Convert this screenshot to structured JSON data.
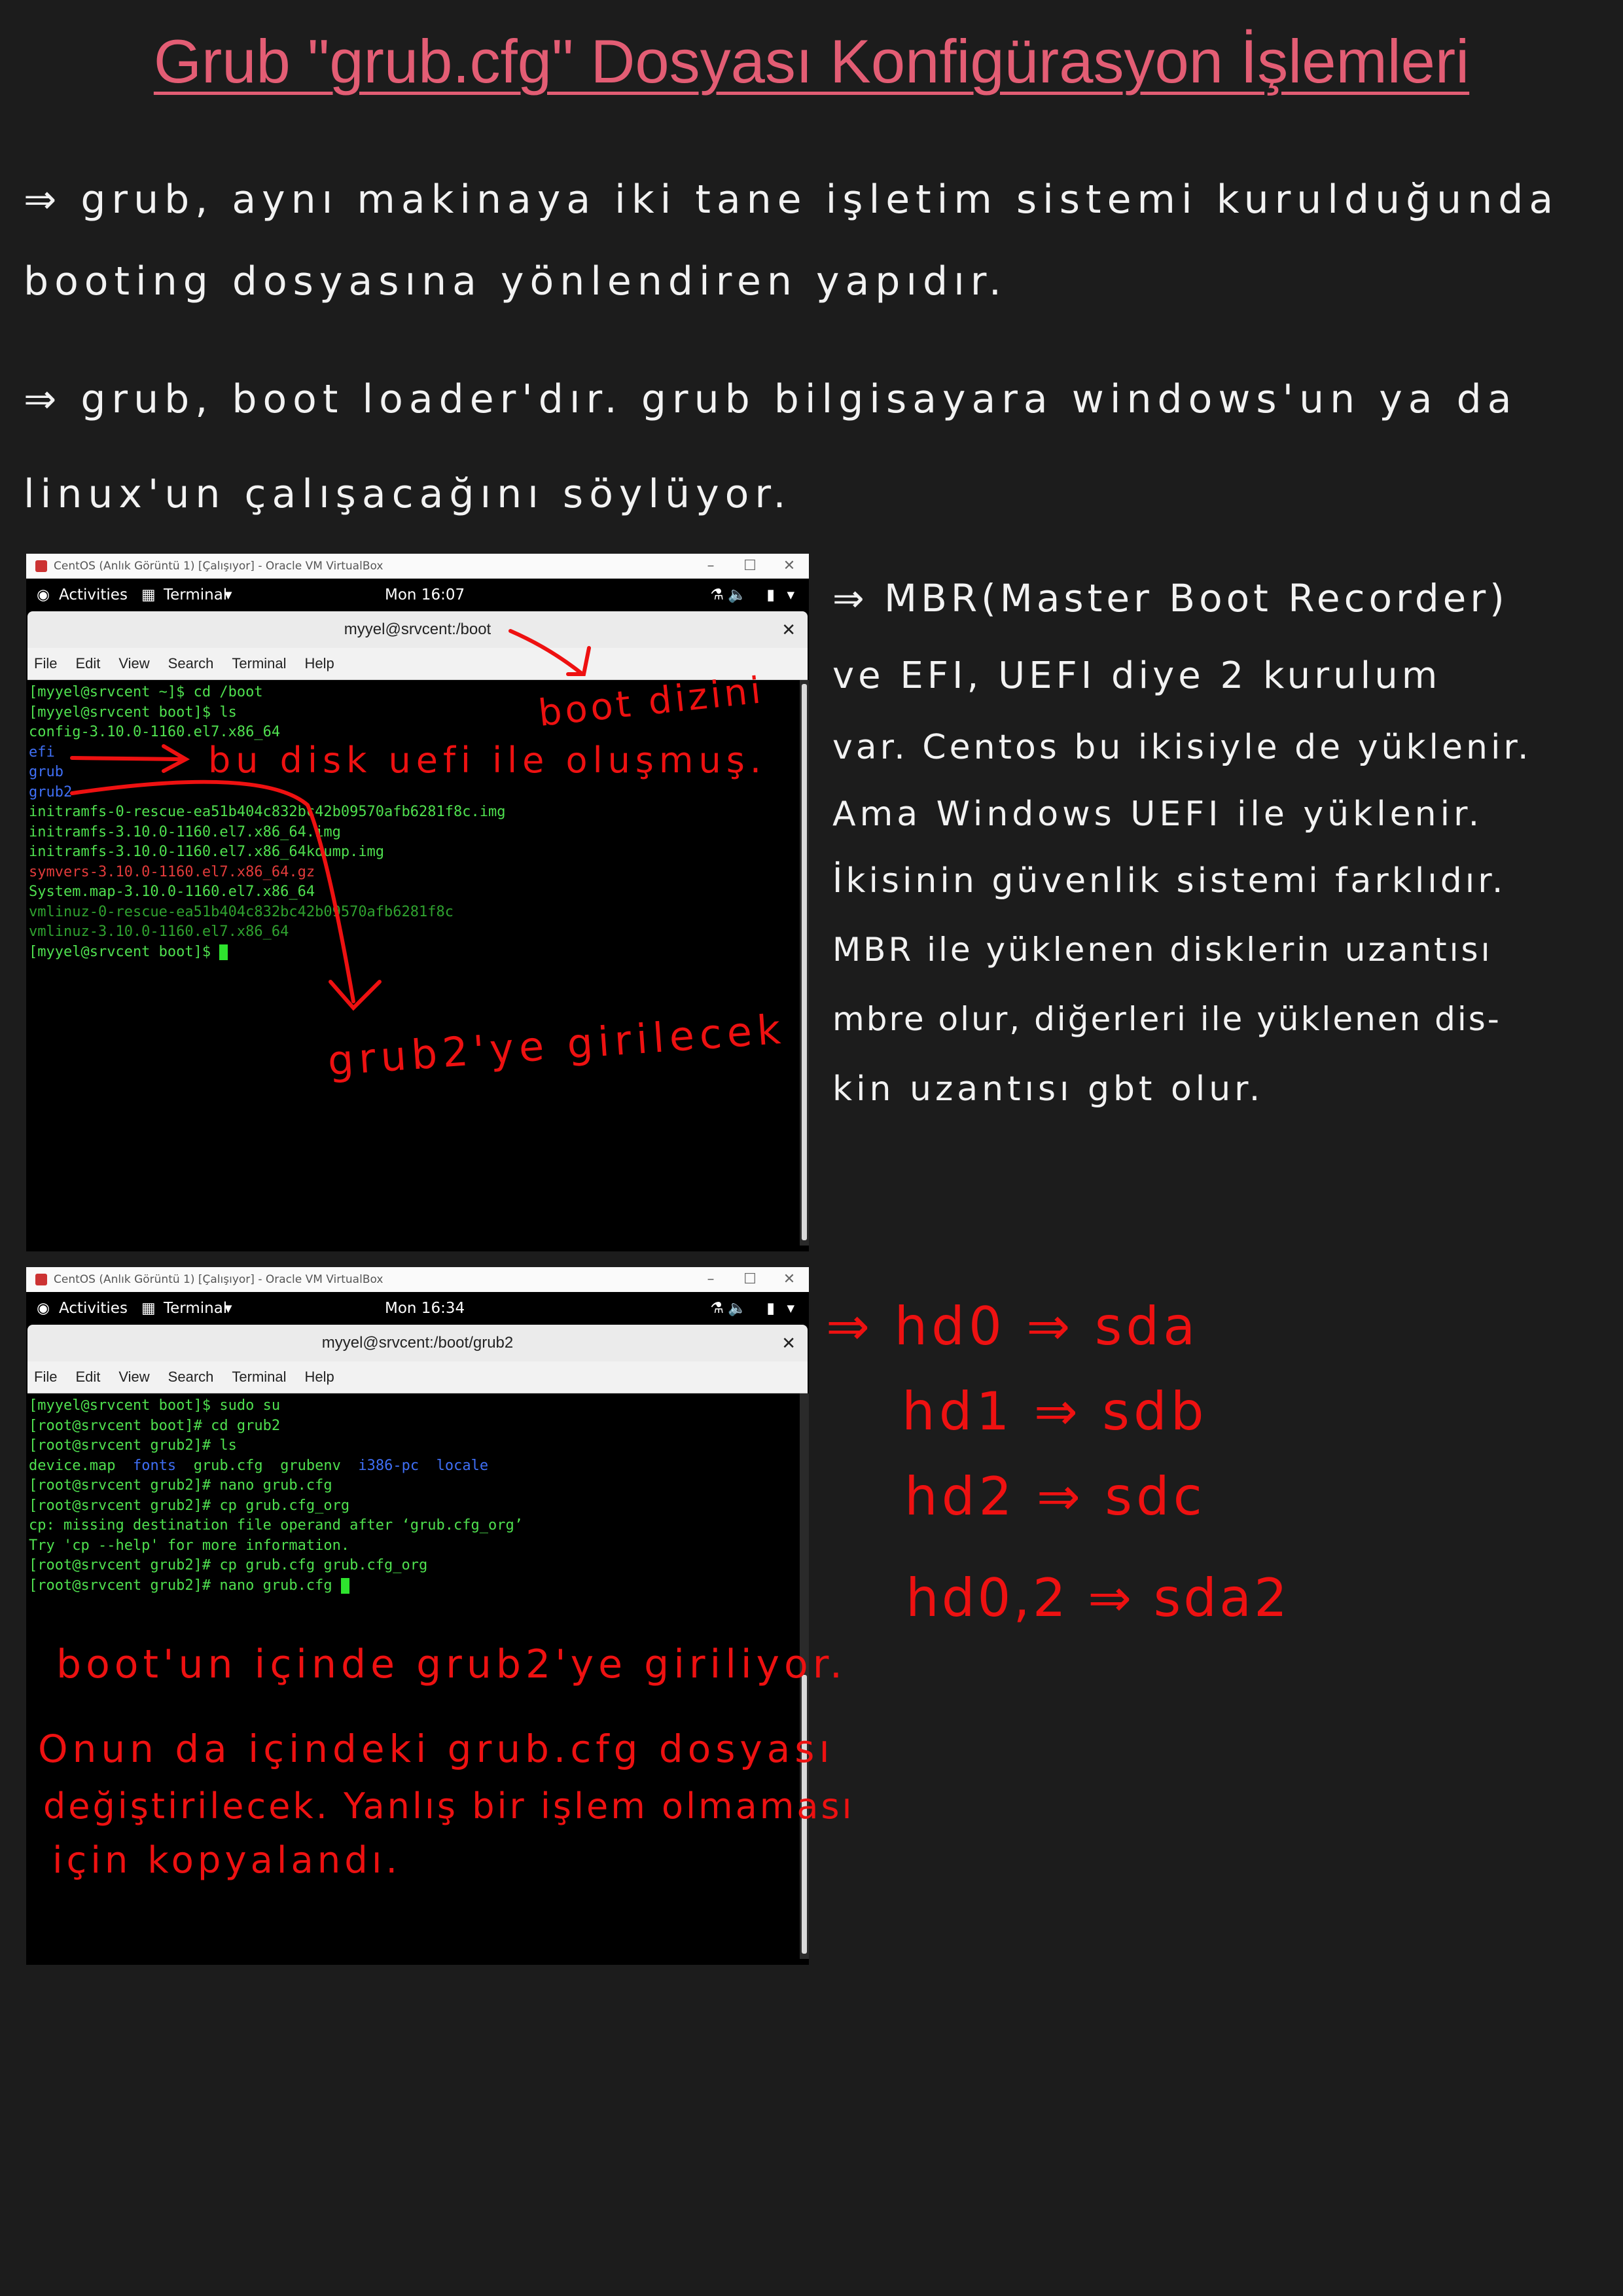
{
  "page_title": "Grub \"grub.cfg\" Dosyası Konfigürasyon İşlemleri",
  "notes": {
    "line1a": "⇒ grub, aynı makinaya iki tane işletim sistemi kurulduğunda",
    "line1b": "booting dosyasına yönlendiren yapıdır.",
    "line2a": "⇒ grub, boot loader'dır. grub bilgisayara windows'un ya da",
    "line2b": "linux'un çalışacağını söylüyor.",
    "mbr1": "⇒ MBR(Master Boot Recorder)",
    "mbr2": "ve EFI, UEFI diye 2 kurulum",
    "mbr3": "var. Centos bu ikisiyle de yüklenir.",
    "mbr4": "Ama Windows UEFI ile yüklenir.",
    "mbr5": "İkisinin güvenlik sistemi farklıdır.",
    "mbr6": "MBR ile yüklenen disklerin uzantısı",
    "mbr7": "mbre olur, diğerleri ile yüklenen dis-",
    "mbr8": "kin uzantısı gbt olur.",
    "hd1": "⇒ hd0 ⇒ sda",
    "hd2": "hd1 ⇒ sdb",
    "hd3": "hd2 ⇒ sdc",
    "hd4": "hd0,2 ⇒ sda2"
  },
  "window1": {
    "vbox_title": "CentOS (Anlık Görüntü 1) [Çalışıyor] - Oracle VM VirtualBox",
    "activities": "Activities",
    "app": "Terminal",
    "clock": "Mon 16:07",
    "term_title": "myyel@srvcent:/boot",
    "menu": [
      "File",
      "Edit",
      "View",
      "Search",
      "Terminal",
      "Help"
    ],
    "lines": [
      "[myyel@srvcent ~]$ cd /boot",
      "[myyel@srvcent boot]$ ls",
      "config-3.10.0-1160.el7.x86_64",
      "efi",
      "grub",
      "grub2",
      "initramfs-0-rescue-ea51b404c832bc42b09570afb6281f8c.img",
      "initramfs-3.10.0-1160.el7.x86_64.img",
      "initramfs-3.10.0-1160.el7.x86_64kdump.img",
      "symvers-3.10.0-1160.el7.x86_64.gz",
      "System.map-3.10.0-1160.el7.x86_64",
      "vmlinuz-0-rescue-ea51b404c832bc42b09570afb6281f8c",
      "vmlinuz-3.10.0-1160.el7.x86_64",
      "[myyel@srvcent boot]$ "
    ],
    "ann_boot": "boot dizini",
    "ann_efi": "bu disk uefi ile oluşmuş.",
    "ann_grub2": "grub2'ye girilecek"
  },
  "window2": {
    "vbox_title": "CentOS (Anlık Görüntü 1) [Çalışıyor] - Oracle VM VirtualBox",
    "activities": "Activities",
    "app": "Terminal",
    "clock": "Mon 16:34",
    "term_title": "myyel@srvcent:/boot/grub2",
    "menu": [
      "File",
      "Edit",
      "View",
      "Search",
      "Terminal",
      "Help"
    ],
    "lines": [
      "[myyel@srvcent boot]$ sudo su",
      "[root@srvcent boot]# cd grub2",
      "[root@srvcent grub2]# ls",
      "",
      "[root@srvcent grub2]# nano grub.cfg",
      "[root@srvcent grub2]# cp grub.cfg_org",
      "cp: missing destination file operand after ‘grub.cfg_org’",
      "Try 'cp --help' for more information.",
      "[root@srvcent grub2]# cp grub.cfg grub.cfg_org",
      "[root@srvcent grub2]# nano grub.cfg "
    ],
    "ls_items": [
      "device.map",
      "fonts",
      "grub.cfg",
      "grubenv",
      "i386-pc",
      "locale"
    ],
    "note1": "boot'un içinde grub2'ye giriliyor.",
    "note2": "Onun da içindeki grub.cfg dosyası",
    "note3": "değiştirilecek. Yanlış bir işlem olmaması",
    "note4": "için kopyalandı."
  },
  "colors": {
    "title": "#e35d74",
    "annotation": "#ee1111",
    "terminal_green": "#4fe04f",
    "terminal_blue": "#3f6ff5"
  }
}
